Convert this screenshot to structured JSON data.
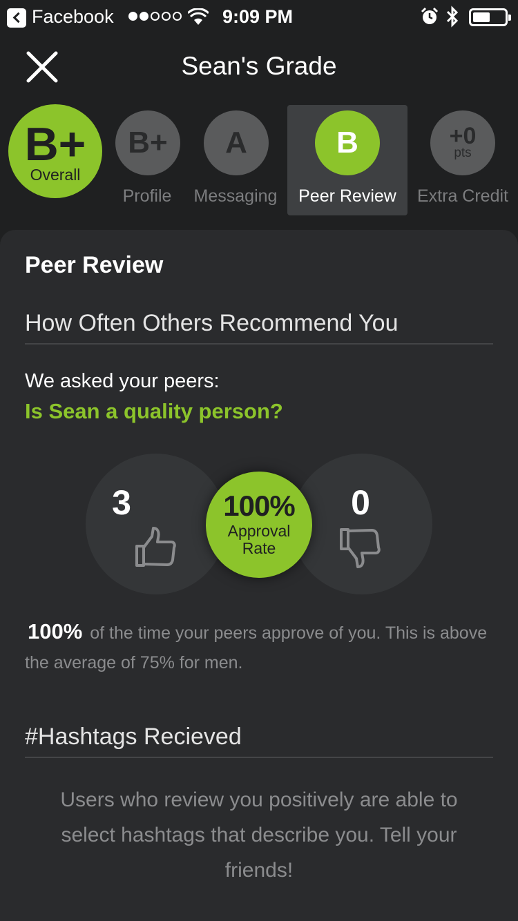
{
  "status_bar": {
    "back_app": "Facebook",
    "signal_dots_filled": 2,
    "signal_dots_total": 5,
    "time": "9:09 PM",
    "battery_level": 0.55
  },
  "header": {
    "title": "Sean's Grade",
    "close_icon": "close-icon"
  },
  "grades": {
    "overall": {
      "grade": "B+",
      "label": "Overall"
    },
    "tabs": [
      {
        "grade": "B+",
        "label": "Profile",
        "active": false
      },
      {
        "grade": "A",
        "label": "Messaging",
        "active": false
      },
      {
        "grade": "B",
        "label": "Peer Review",
        "active": true
      },
      {
        "grade": "+0",
        "unit": "pts",
        "label": "Extra Credit",
        "active": false
      }
    ]
  },
  "peer_review": {
    "title": "Peer Review",
    "recommend_heading": "How Often Others Recommend You",
    "asked": "We asked your peers:",
    "question": "Is Sean a quality person?",
    "thumbs_up_count": "3",
    "thumbs_down_count": "0",
    "approval_rate": "100%",
    "approval_label": "Approval Rate",
    "stat_value": "100%",
    "stat_text": "of the time your peers approve of you. This is above the average of 75% for men.",
    "hashtags_heading": "#Hashtags Recieved",
    "hashtags_text": "Users who review you positively are able to select hashtags that describe you. Tell your friends!"
  },
  "colors": {
    "background": "#1f2021",
    "card": "#2a2b2d",
    "accent_green": "#8cc42b",
    "inactive_grey": "#5a5b5c",
    "muted_text": "#8b8c8e"
  }
}
